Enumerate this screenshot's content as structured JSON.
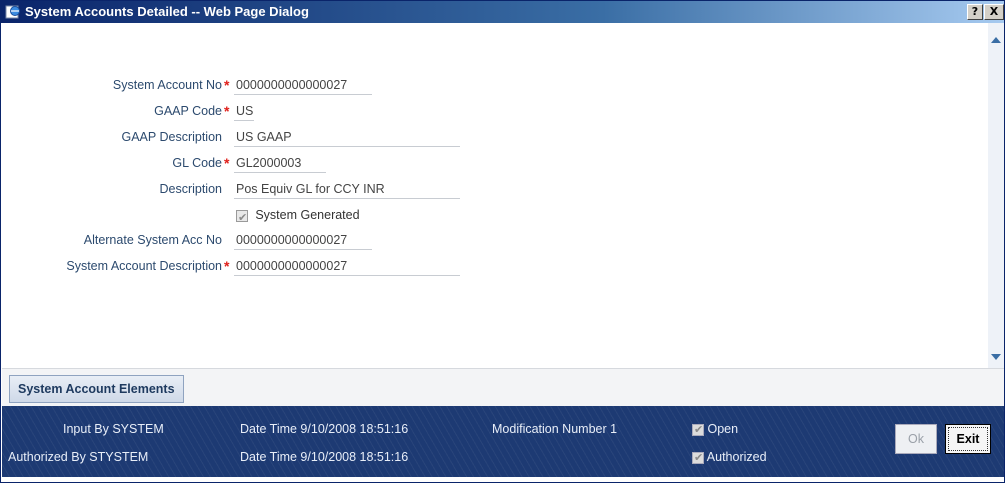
{
  "window": {
    "title": "System Accounts Detailed -- Web Page Dialog",
    "help_label": "?",
    "close_label": "X"
  },
  "form": {
    "system_account_no": {
      "label": "System Account No",
      "value": "0000000000000027"
    },
    "gaap_code": {
      "label": "GAAP Code",
      "value": "US"
    },
    "gaap_description": {
      "label": "GAAP Description",
      "value": "US GAAP"
    },
    "gl_code": {
      "label": "GL Code",
      "value": "GL2000003"
    },
    "description": {
      "label": "Description",
      "value": "Pos Equiv GL for CCY INR"
    },
    "system_generated": {
      "label": "System Generated",
      "checked": true
    },
    "alternate_system_acc_no": {
      "label": "Alternate System Acc No",
      "value": "0000000000000027"
    },
    "system_account_description": {
      "label": "System Account Description",
      "value": "0000000000000027"
    },
    "required_mark": "*"
  },
  "tabs": {
    "system_account_elements": "System Account Elements"
  },
  "footer": {
    "input_by": "Input By SYSTEM",
    "authorized_by": "Authorized By STYSTEM",
    "input_datetime": "Date Time 9/10/2008 18:51:16",
    "auth_datetime": "Date Time 9/10/2008 18:51:16",
    "modification_number": "Modification Number 1",
    "open_label": "Open",
    "authorized_label": "Authorized",
    "ok_label": "Ok",
    "exit_label": "Exit"
  },
  "colors": {
    "title_bar": "#0a246a",
    "footer_bg": "#1d3a73",
    "required": "#e0201b",
    "label": "#2c4a6e"
  }
}
